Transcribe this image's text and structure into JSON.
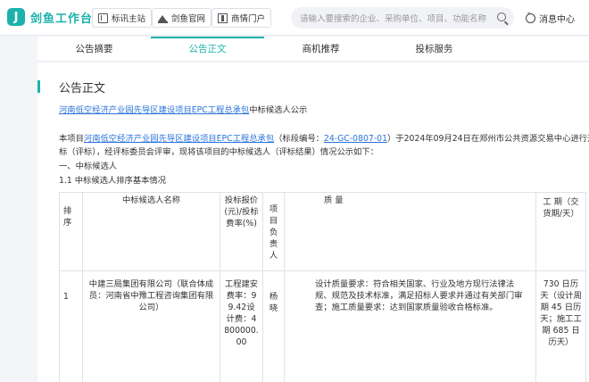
{
  "app": {
    "logo_char": "J",
    "name": "剑鱼工作台"
  },
  "header_nav": [
    {
      "label": "标讯主站",
      "icon": "bookmark-icon"
    },
    {
      "label": "剑鱼官网",
      "icon": "crown-icon"
    },
    {
      "label": "商情门户",
      "icon": "door-icon"
    }
  ],
  "search": {
    "placeholder": "请输入要搜索的企业、采购单位、项目、功能名称"
  },
  "message_center": {
    "label": "消息中心"
  },
  "tabs": [
    {
      "label": "公告摘要",
      "active": false
    },
    {
      "label": "公告正文",
      "active": true
    },
    {
      "label": "商机推荐",
      "active": false
    },
    {
      "label": "投标服务",
      "active": false
    }
  ],
  "section": {
    "title": "公告正文"
  },
  "notice": {
    "title_link": "河南低空经济产业园先导区建设项目EPC工程总承包",
    "title_suffix": "中标候选人公示",
    "intro_prefix": "本项目",
    "intro_link": "河南低空经济产业园先导区建设项目EPC工程总承包",
    "intro_mid": "（标段编号：",
    "bid_code": "24-GC-0807-01",
    "intro_rest": "）于2024年09月24日在郑州市公共资源交易中心进行开",
    "intro_line2": "标（评标），经评标委员会评审，现将该项目的中标候选人（评标结果）情况公示如下：",
    "h1": "一、中标候选人",
    "h2": "1.1 中标候选人排序基本情况"
  },
  "table": {
    "headers": {
      "rank": "排序",
      "name": "中标候选人名称",
      "price": "投标报价(元)/投标费率(%)",
      "manager": "项目负责人",
      "quality": "质 量",
      "period": "工 期（交货期/天）"
    },
    "rows": [
      {
        "rank": "1",
        "name": "中建三局集团有限公司（联合体成员：河南省中豫工程咨询集团有限公司）",
        "price": "工程建安费率：99.42设计费：4800000.00",
        "manager": "杨晓",
        "quality": "设计质量要求：符合相关国家、行业及地方现行法律法规、规范及技术标准，满足招标人要求并通过有关部门审查；施工质量要求：达到国家质量验收合格标准。",
        "period": "730 日历天（设计周期 45 日历天；施工工期 685 日历天）"
      }
    ]
  },
  "colors": {
    "accent": "#1db1ac",
    "link": "#2a73d9"
  }
}
